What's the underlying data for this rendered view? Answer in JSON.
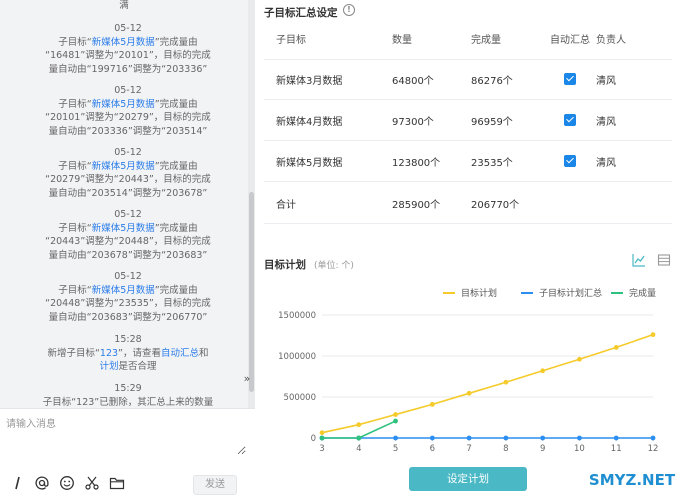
{
  "feed": {
    "top_fragment": "满",
    "entries": [
      {
        "time": "05-12",
        "l1a": "子目标“",
        "link": "新媒体5月数据",
        "l1b": "”完成量由",
        "l2": "“16481”调整为“20101”，目标的完成",
        "l3": "量自动由“199716”调整为“203336”"
      },
      {
        "time": "05-12",
        "l1a": "子目标“",
        "link": "新媒体5月数据",
        "l1b": "”完成量由",
        "l2": "“20101”调整为“20279”，目标的完成",
        "l3": "量自动由“203336”调整为“203514”"
      },
      {
        "time": "05-12",
        "l1a": "子目标“",
        "link": "新媒体5月数据",
        "l1b": "”完成量由",
        "l2": "“20279”调整为“20443”，目标的完成",
        "l3": "量自动由“203514”调整为“203678”"
      },
      {
        "time": "05-12",
        "l1a": "子目标“",
        "link": "新媒体5月数据",
        "l1b": "”完成量由",
        "l2": "“20443”调整为“20448”，目标的完成",
        "l3": "量自动由“203678”调整为“203683”"
      },
      {
        "time": "05-12",
        "l1a": "子目标“",
        "link": "新媒体5月数据",
        "l1b": "”完成量由",
        "l2": "“20448”调整为“23535”，目标的完成",
        "l3": "量自动由“203683”调整为“206770”"
      }
    ],
    "new_entry": {
      "time": "15:28",
      "a": "新增子目标“",
      "link1": "123",
      "b": "”，请查看",
      "link2": "自动汇总",
      "c": "和",
      "link3": "计划",
      "d": "是否合理"
    },
    "last_entry": {
      "time": "15:29",
      "text": "子目标“123”已删除，其汇总上来的数量"
    }
  },
  "input": {
    "placeholder": "请输入消息"
  },
  "toolbar": {
    "send_label": "发送"
  },
  "summary": {
    "title": "子目标汇总设定",
    "info_glyph": "!",
    "headers": [
      "子目标",
      "数量",
      "完成量",
      "自动汇总",
      "负责人"
    ],
    "rows": [
      {
        "name": "新媒体3月数据",
        "qty": "64800个",
        "done": "86276个",
        "auto": true,
        "owner": "清风"
      },
      {
        "name": "新媒体4月数据",
        "qty": "97300个",
        "done": "96959个",
        "auto": true,
        "owner": "清风"
      },
      {
        "name": "新媒体5月数据",
        "qty": "123800个",
        "done": "23535个",
        "auto": true,
        "owner": "清风"
      }
    ],
    "total": {
      "name": "合计",
      "qty": "285900个",
      "done": "206770个"
    }
  },
  "plan": {
    "title": "目标计划",
    "unit": "(单位: 个)",
    "button_label": "设定计划"
  },
  "chart_data": {
    "type": "line",
    "x": [
      3,
      4,
      5,
      6,
      7,
      8,
      9,
      10,
      11,
      12
    ],
    "ylim": [
      0,
      1500000
    ],
    "yticks": [
      "0",
      "500000",
      "1000000",
      "1500000"
    ],
    "ytick_values": [
      0,
      500000,
      1000000,
      1500000
    ],
    "grid": true,
    "legend_position": "top-right",
    "series": [
      {
        "name": "目标计划",
        "color": "#f5cb2c",
        "values": [
          64800,
          162100,
          285900,
          410000,
          545000,
          680000,
          820000,
          960000,
          1105000,
          1260000
        ]
      },
      {
        "name": "子目标计划汇总",
        "color": "#2b8ef0",
        "values": [
          0,
          0,
          0,
          0,
          0,
          0,
          0,
          0,
          0,
          0
        ]
      },
      {
        "name": "完成量",
        "color": "#2ec27e",
        "values": [
          0,
          0,
          206770
        ]
      }
    ]
  },
  "watermark": {
    "text": "SMYZ.NET"
  }
}
